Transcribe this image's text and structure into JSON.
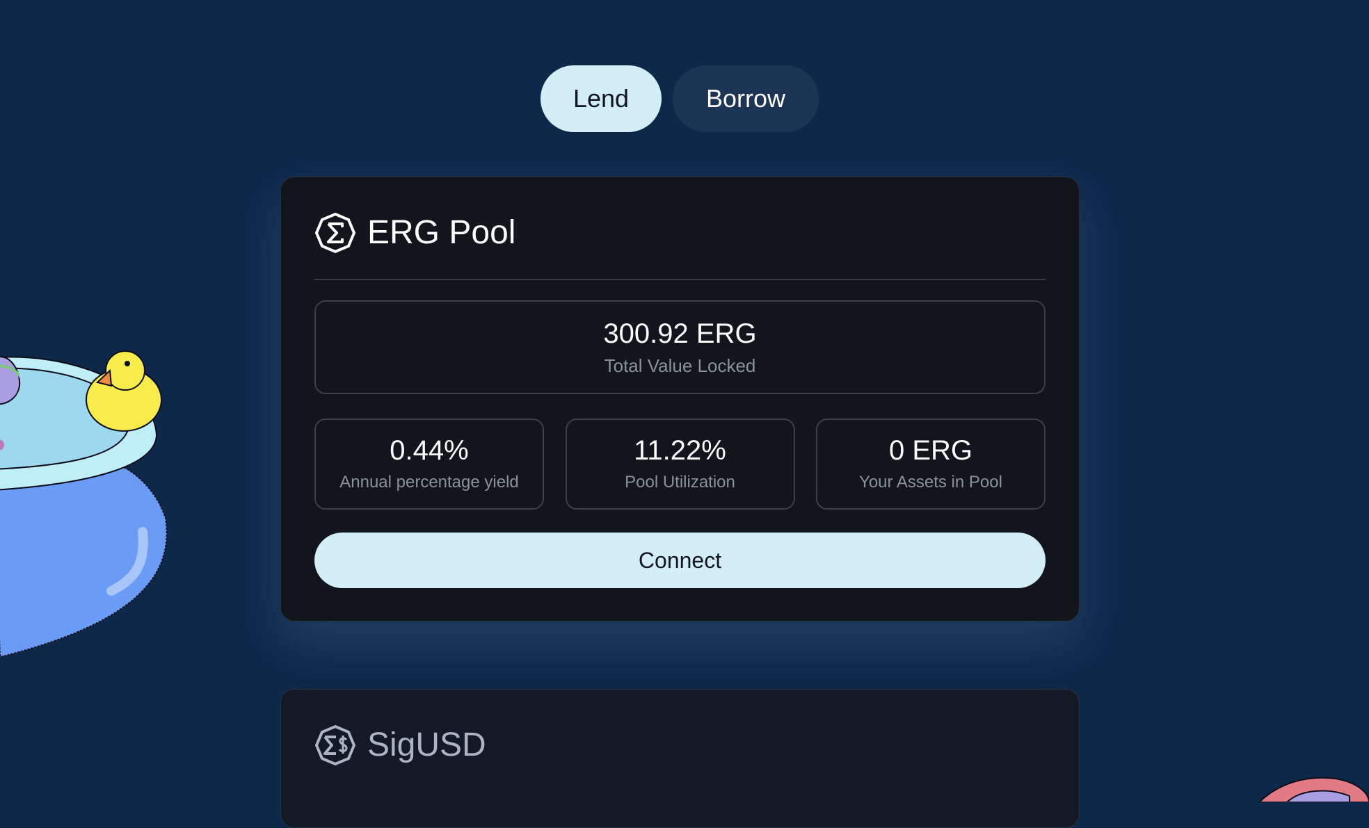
{
  "tabs": {
    "lend_label": "Lend",
    "borrow_label": "Borrow",
    "active": "Lend"
  },
  "erg_pool": {
    "title": "ERG Pool",
    "tvl_value": "300.92 ERG",
    "tvl_label": "Total Value Locked",
    "stats": [
      {
        "value": "0.44%",
        "label": "Annual percentage yield"
      },
      {
        "value": "11.22%",
        "label": "Pool Utilization"
      },
      {
        "value": "0 ERG",
        "label": "Your Assets in Pool"
      }
    ],
    "connect_label": "Connect",
    "icon": "erg-icon"
  },
  "sigusd_pool": {
    "title": "SigUSD",
    "icon": "sigusd-icon"
  },
  "colors": {
    "background": "#0e284a",
    "card": "#12151c",
    "accent": "#d3eef6",
    "secondary_tab": "#1d3555"
  }
}
